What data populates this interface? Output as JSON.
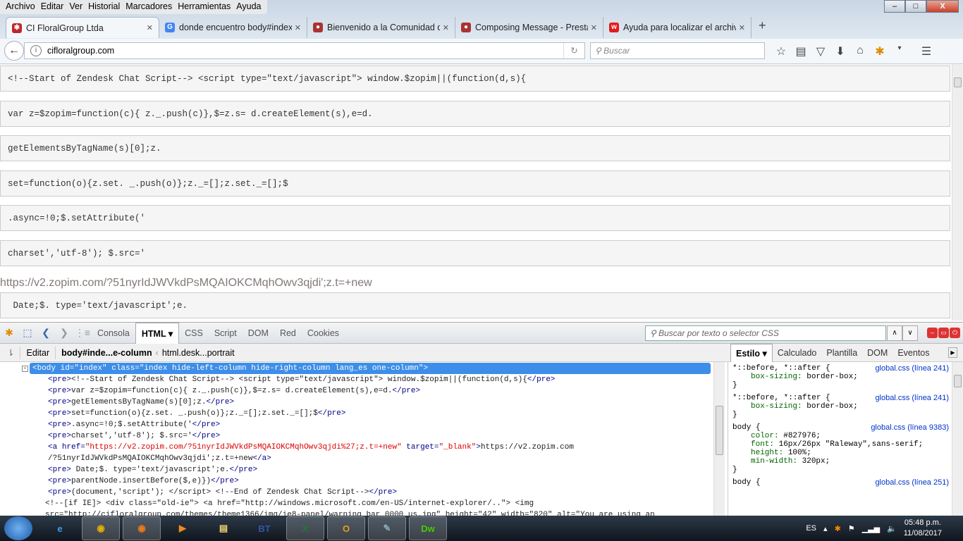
{
  "menu": [
    "Archivo",
    "Editar",
    "Ver",
    "Historial",
    "Marcadores",
    "Herramientas",
    "Ayuda"
  ],
  "window_buttons": {
    "minimize": "–",
    "maximize": "□",
    "close": "X"
  },
  "tabs": [
    {
      "label": "CI FloralGroup Ltda",
      "fav": "✱",
      "color": "#c0252b"
    },
    {
      "label": "donde encuentro body#index",
      "fav": "G",
      "color": "#4285f4"
    },
    {
      "label": "Bienvenido a la Comunidad de",
      "fav": "●",
      "color": "#a33"
    },
    {
      "label": "Composing Message - PrestaShop",
      "fav": "●",
      "color": "#a33"
    },
    {
      "label": "Ayuda para localizar el archivo",
      "fav": "w",
      "color": "#e21b1b"
    }
  ],
  "new_tab": "+",
  "url": "cifloralgroup.com",
  "search_placeholder": "Buscar",
  "page": {
    "boxes": [
      "<!--Start of Zendesk Chat Script--> <script type=\"text/javascript\"> window.$zopim||(function(d,s){",
      "var z=$zopim=function(c){ z._.push(c)},$=z.s= d.createElement(s),e=d.",
      "getElementsByTagName(s)[0];z.",
      "set=function(o){z.set. _.push(o)};z._=[];z.set._=[];$",
      ".async=!0;$.setAttribute('",
      "charset','utf-8'); $.src='"
    ],
    "link": "https://v2.zopim.com/?51nyrIdJWVkdPsMQAIOKCMqhOwv3qjdi';z.t=+new",
    "box_last": " Date;$. type='text/javascript';e."
  },
  "devtools": {
    "panels": [
      "Consola",
      "HTML ▾",
      "CSS",
      "Script",
      "DOM",
      "Red",
      "Cookies"
    ],
    "active_panel": 1,
    "search_placeholder": "Buscar por texto o selector CSS",
    "edit": "Editar",
    "breadcrumb": [
      "body#inde...e-column",
      "html.desk...portrait"
    ],
    "side_tabs": [
      "Estilo ▾",
      "Calculado",
      "Plantilla",
      "DOM",
      "Eventos"
    ],
    "tree": [
      {
        "indent": 0,
        "sel": true,
        "parts": [
          [
            "tx",
            "<body id=\"index\" class=\"index hide-left-column hide-right-column lang_es one-column\">"
          ]
        ]
      },
      {
        "indent": 1,
        "parts": [
          [
            "tag",
            "<pre>"
          ],
          [
            "tx",
            "<!--Start of Zendesk Chat Script--> <script type=\"text/javascript\"> window.$zopim||(function(d,s){"
          ],
          [
            "tag",
            "</pre>"
          ]
        ]
      },
      {
        "indent": 1,
        "parts": [
          [
            "tag",
            "<pre>"
          ],
          [
            "tx",
            "var z=$zopim=function(c){ z._.push(c)},$=z.s= d.createElement(s),e=d."
          ],
          [
            "tag",
            "</pre>"
          ]
        ]
      },
      {
        "indent": 1,
        "parts": [
          [
            "tag",
            "<pre>"
          ],
          [
            "tx",
            "getElementsByTagName(s)[0];z."
          ],
          [
            "tag",
            "</pre>"
          ]
        ]
      },
      {
        "indent": 1,
        "parts": [
          [
            "tag",
            "<pre>"
          ],
          [
            "tx",
            "set=function(o){z.set. _.push(o)};z._=[];z.set._=[];$"
          ],
          [
            "tag",
            "</pre>"
          ]
        ]
      },
      {
        "indent": 1,
        "parts": [
          [
            "tag",
            "<pre>"
          ],
          [
            "tx",
            ".async=!0;$.setAttribute('"
          ],
          [
            "tag",
            "</pre>"
          ]
        ]
      },
      {
        "indent": 1,
        "parts": [
          [
            "tag",
            "<pre>"
          ],
          [
            "tx",
            "charset','utf-8'); $.src='"
          ],
          [
            "tag",
            "</pre>"
          ]
        ]
      },
      {
        "indent": 1,
        "parts": [
          [
            "tag",
            "<a "
          ],
          [
            "an",
            "href="
          ],
          [
            "av",
            "\"https://v2.zopim.com/?51nyrIdJWVkdPsMQAIOKCMqhOwv3qjdi%27;z.t=+new\""
          ],
          [
            "an",
            " target="
          ],
          [
            "av",
            "\"_blank\""
          ],
          [
            "tag",
            ">"
          ],
          [
            "tx",
            "https://v2.zopim.com"
          ]
        ]
      },
      {
        "indent": 1,
        "parts": [
          [
            "tx",
            "/?51nyrIdJWVkdPsMQAIOKCMqhOwv3qjdi';z.t=+new"
          ],
          [
            "tag",
            "</a>"
          ]
        ]
      },
      {
        "indent": 1,
        "parts": [
          [
            "tag",
            "<pre>"
          ],
          [
            "tx",
            " Date;$. type='text/javascript';e."
          ],
          [
            "tag",
            "</pre>"
          ]
        ]
      },
      {
        "indent": 1,
        "parts": [
          [
            "tag",
            "<pre>"
          ],
          [
            "tx",
            "parentNode.insertBefore($,e)})"
          ],
          [
            "tag",
            "</pre>"
          ]
        ]
      },
      {
        "indent": 1,
        "parts": [
          [
            "tag",
            "<pre>"
          ],
          [
            "tx",
            "(document,'script'); </script> <!--End of Zendesk Chat Script-->"
          ],
          [
            "tag",
            "</pre>"
          ]
        ]
      },
      {
        "indent": 2,
        "parts": [
          [
            "tx",
            "<!--[if IE]> <div class=\"old-ie\"> <a href=\"http://windows.microsoft.com/en-US/internet-explorer/..\"> <img"
          ]
        ]
      },
      {
        "indent": 2,
        "parts": [
          [
            "tx",
            "src=\"http://cifloralgroup.com/themes/theme1366/img/ie8-panel/warning_bar_0000_us.jpg\" height=\"42\" width=\"820\" alt=\"You are using an"
          ]
        ]
      }
    ],
    "rules": [
      {
        "selector": "*::before, *::after {",
        "source": "global.css (línea 241)",
        "props": [
          [
            "box-sizing",
            "border-box;"
          ]
        ]
      },
      {
        "selector": "*::before, *::after {",
        "source": "global.css (línea 241)",
        "props": [
          [
            "box-sizing",
            "border-box;"
          ]
        ]
      },
      {
        "selector": "body {",
        "source": "global.css (línea 9383)",
        "props": [
          [
            "color",
            "#827976;"
          ],
          [
            "font",
            "16px/26px \"Raleway\",sans-serif;"
          ],
          [
            "height",
            "100%;"
          ],
          [
            "min-width",
            "320px;"
          ]
        ]
      },
      {
        "selector": "body {",
        "source": "global.css (línea 251)",
        "props": []
      }
    ]
  },
  "taskbar": {
    "apps": [
      {
        "n": "internet-explorer",
        "g": "e",
        "c": "#3aa0e8"
      },
      {
        "n": "chrome",
        "g": "◉",
        "c": "#e8b000",
        "on": true
      },
      {
        "n": "firefox",
        "g": "◉",
        "c": "#f07a18",
        "on": true
      },
      {
        "n": "media-player",
        "g": "▶",
        "c": "#f08a20"
      },
      {
        "n": "file-explorer",
        "g": "▤",
        "c": "#f0d070"
      },
      {
        "n": "bartender",
        "g": "BT",
        "c": "#3355aa"
      },
      {
        "n": "excel",
        "g": "X",
        "c": "#1f7a3a",
        "on": true
      },
      {
        "n": "outlook",
        "g": "O",
        "c": "#e0a020",
        "on": true
      },
      {
        "n": "notes",
        "g": "✎",
        "c": "#8ab",
        "on": true
      },
      {
        "n": "dreamweaver",
        "g": "Dw",
        "c": "#4c0",
        "on": true
      }
    ],
    "lang": "ES",
    "time": "05:48 p.m.",
    "date": "11/08/2017"
  }
}
